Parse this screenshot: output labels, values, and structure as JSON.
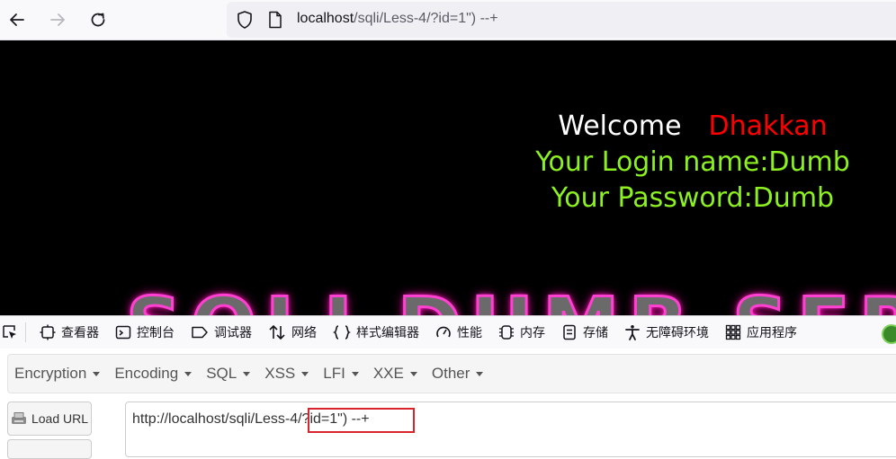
{
  "browser": {
    "url_host": "localhost",
    "url_path": "/sqli/Less-4/?id=1\") --+"
  },
  "page": {
    "welcome_word": "Welcome",
    "welcome_name": "Dhakkan",
    "login_line": "Your Login name:Dumb",
    "password_line": "Your Password:Dumb",
    "banner_text": "SQLI DUMB SERIES"
  },
  "devtools": {
    "tabs": [
      {
        "label": "查看器",
        "icon": "inspector-icon"
      },
      {
        "label": "控制台",
        "icon": "console-icon"
      },
      {
        "label": "调试器",
        "icon": "debugger-icon"
      },
      {
        "label": "网络",
        "icon": "network-icon"
      },
      {
        "label": "样式编辑器",
        "icon": "style-editor-icon"
      },
      {
        "label": "性能",
        "icon": "performance-icon"
      },
      {
        "label": "内存",
        "icon": "memory-icon"
      },
      {
        "label": "存储",
        "icon": "storage-icon"
      },
      {
        "label": "无障碍环境",
        "icon": "accessibility-icon"
      },
      {
        "label": "应用程序",
        "icon": "application-icon"
      }
    ]
  },
  "hackbar": {
    "menu": [
      "Encryption",
      "Encoding",
      "SQL",
      "XSS",
      "LFI",
      "XXE",
      "Other"
    ],
    "load_url_label": "Load URL",
    "url_value": "http://localhost/sqli/Less-4/?id=1\") --+"
  },
  "colors": {
    "page_bg": "#000000",
    "welcome": "#ffffff",
    "name": "#ff0000",
    "info": "#8cf021",
    "highlight": "#d9232d"
  }
}
